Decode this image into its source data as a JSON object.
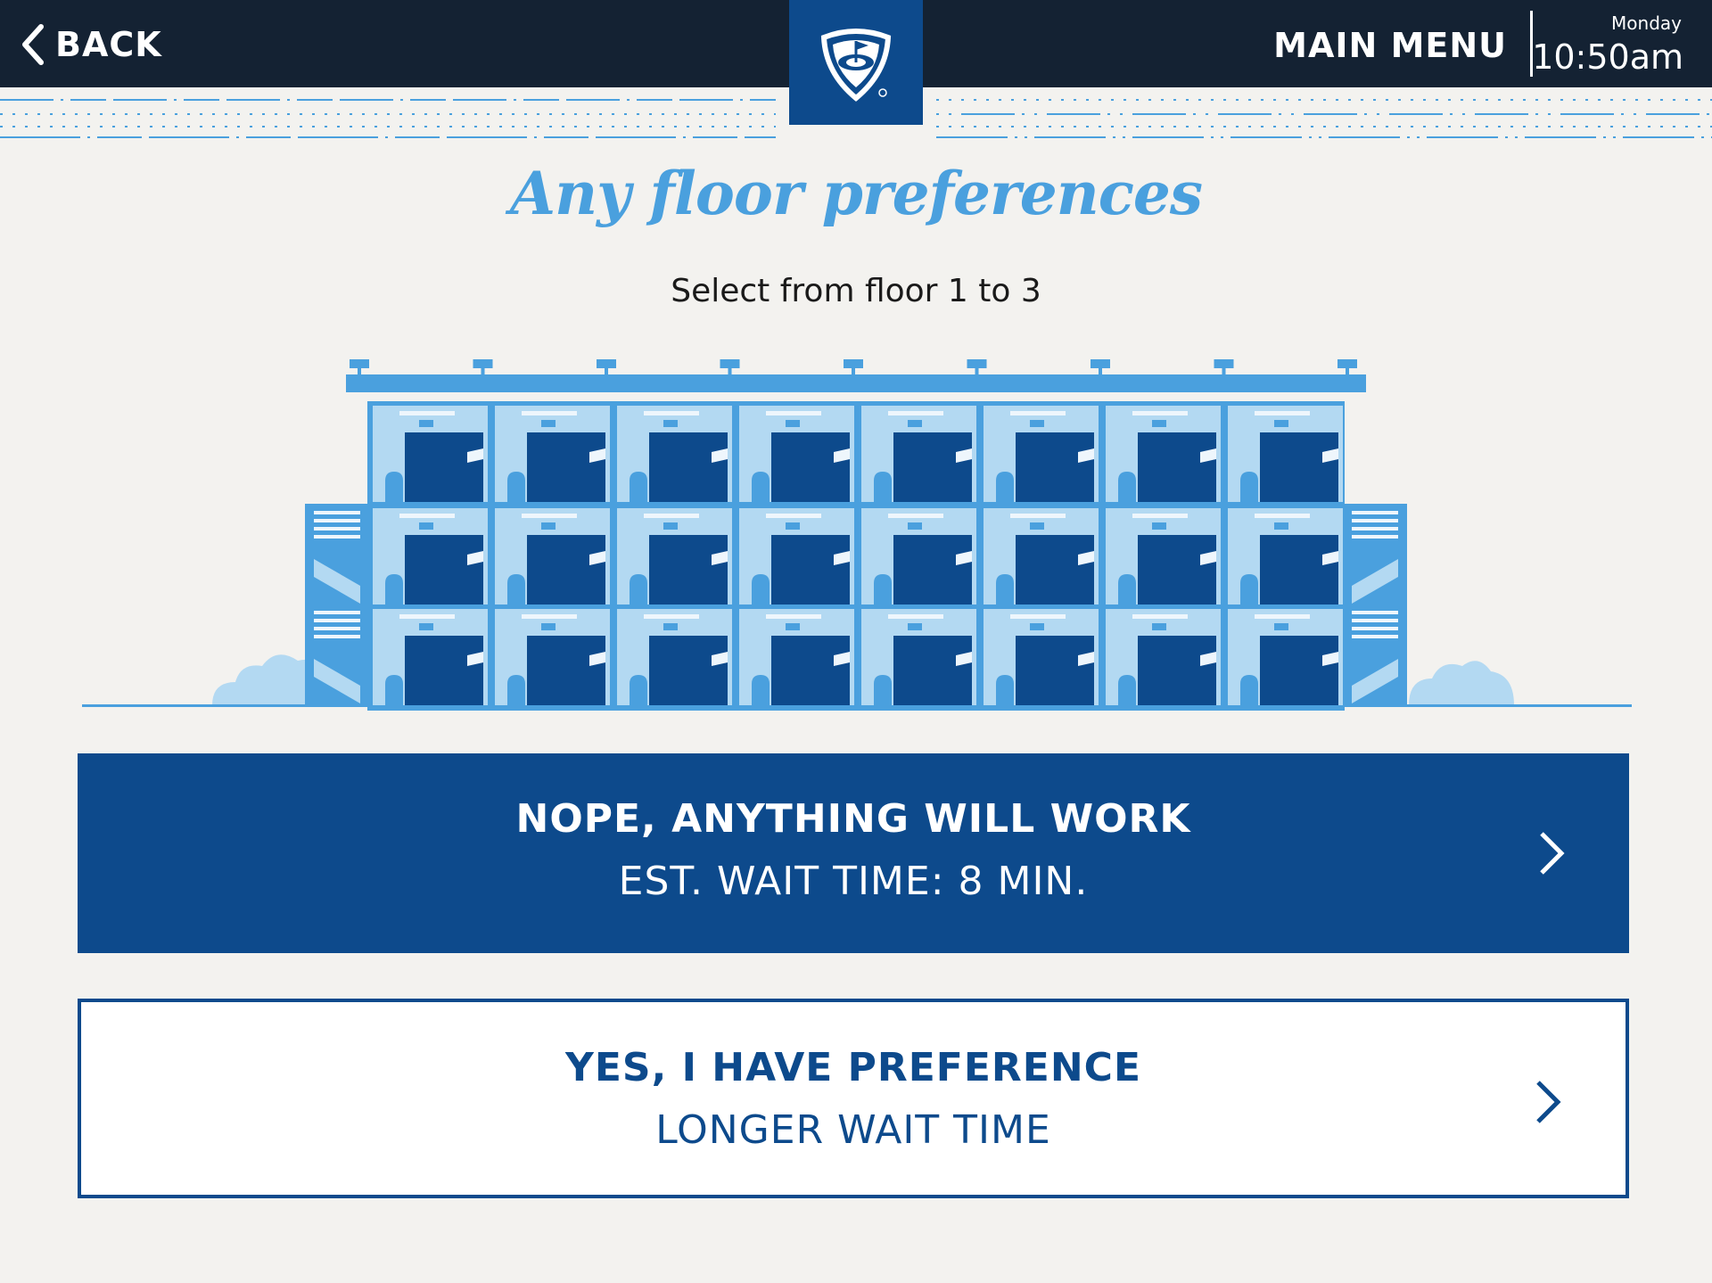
{
  "header": {
    "back_label": "BACK",
    "main_menu_label": "MAIN MENU",
    "day": "Monday",
    "time": "10:50am",
    "logo_icon": "golf-shield-logo-icon"
  },
  "page": {
    "title": "Any floor preferences",
    "subtitle": "Select from floor 1 to 3"
  },
  "options": [
    {
      "line1": "NOPE, ANYTHING WILL WORK",
      "line2": "EST. WAIT TIME: 8 MIN."
    },
    {
      "line1": "YES, I HAVE PREFERENCE",
      "line2": "LONGER WAIT TIME"
    }
  ],
  "colors": {
    "navy": "#0d4a8c",
    "dark_bar": "#142233",
    "light_blue": "#4aa0de",
    "background": "#f3f2ef"
  }
}
